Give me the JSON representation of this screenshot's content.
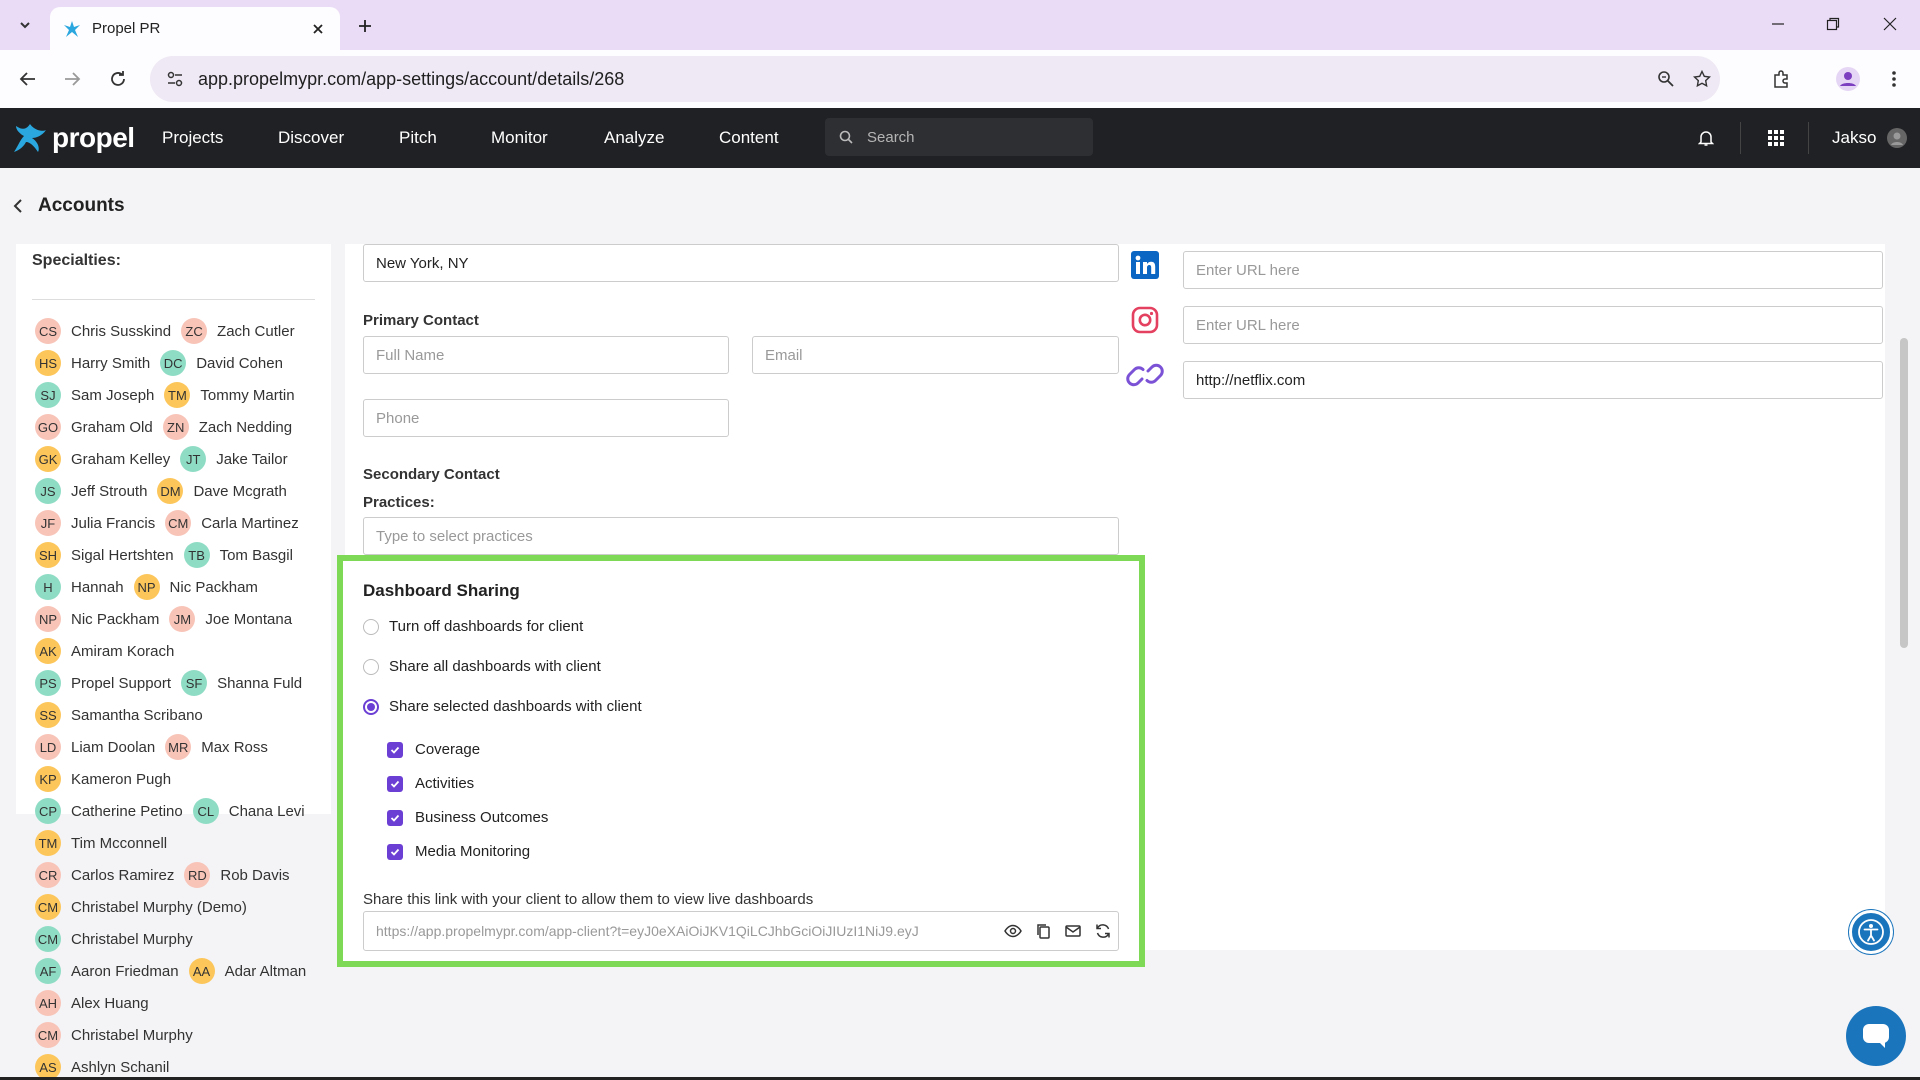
{
  "browser": {
    "tab_title": "Propel PR",
    "url": "app.propelmypr.com/app-settings/account/details/268"
  },
  "nav": {
    "logo_text": "propel",
    "links": [
      "Projects",
      "Discover",
      "Pitch",
      "Monitor",
      "Analyze",
      "Content"
    ],
    "search_placeholder": "Search",
    "username": "Jakso"
  },
  "page": {
    "back_label": "Accounts"
  },
  "sidebar": {
    "specialties_label": "Specialties:",
    "rows": [
      [
        {
          "initials": "CS",
          "name": "Chris Susskind",
          "color": "#f8c4b8"
        },
        {
          "initials": "ZC",
          "name": "Zach Cutler",
          "color": "#f8c4b8"
        }
      ],
      [
        {
          "initials": "HS",
          "name": "Harry Smith",
          "color": "#fcc65b"
        },
        {
          "initials": "DC",
          "name": "David Cohen",
          "color": "#8fdcc5"
        }
      ],
      [
        {
          "initials": "SJ",
          "name": "Sam Joseph",
          "color": "#8fdcc5"
        },
        {
          "initials": "TM",
          "name": "Tommy Martin",
          "color": "#fcc65b"
        }
      ],
      [
        {
          "initials": "GO",
          "name": "Graham Old",
          "color": "#f8c4b8"
        },
        {
          "initials": "ZN",
          "name": "Zach Nedding",
          "color": "#f8c4b8"
        }
      ],
      [
        {
          "initials": "GK",
          "name": "Graham Kelley",
          "color": "#fcc65b"
        },
        {
          "initials": "JT",
          "name": "Jake Tailor",
          "color": "#8fdcc5"
        }
      ],
      [
        {
          "initials": "JS",
          "name": "Jeff Strouth",
          "color": "#8fdcc5"
        },
        {
          "initials": "DM",
          "name": "Dave Mcgrath",
          "color": "#fcc65b"
        }
      ],
      [
        {
          "initials": "JF",
          "name": "Julia Francis",
          "color": "#f8c4b8"
        },
        {
          "initials": "CM",
          "name": "Carla Martinez",
          "color": "#f8c4b8"
        }
      ],
      [
        {
          "initials": "SH",
          "name": "Sigal Hertshten",
          "color": "#fcc65b"
        },
        {
          "initials": "TB",
          "name": "Tom Basgil",
          "color": "#8fdcc5"
        }
      ],
      [
        {
          "initials": "H",
          "name": "Hannah",
          "color": "#8fdcc5"
        },
        {
          "initials": "NP",
          "name": "Nic Packham",
          "color": "#fcc65b"
        }
      ],
      [
        {
          "initials": "NP",
          "name": "Nic Packham",
          "color": "#f8c4b8"
        },
        {
          "initials": "JM",
          "name": "Joe Montana",
          "color": "#f8c4b8"
        }
      ],
      [
        {
          "initials": "AK",
          "name": "Amiram Korach",
          "color": "#fcc65b"
        }
      ],
      [
        {
          "initials": "PS",
          "name": "Propel Support",
          "color": "#8fdcc5"
        },
        {
          "initials": "SF",
          "name": "Shanna Fuld",
          "color": "#8fdcc5"
        }
      ],
      [
        {
          "initials": "SS",
          "name": "Samantha Scribano",
          "color": "#fcc65b"
        }
      ],
      [
        {
          "initials": "LD",
          "name": "Liam Doolan",
          "color": "#f8c4b8"
        },
        {
          "initials": "MR",
          "name": "Max Ross",
          "color": "#f8c4b8"
        }
      ],
      [
        {
          "initials": "KP",
          "name": "Kameron Pugh",
          "color": "#fcc65b"
        }
      ],
      [
        {
          "initials": "CP",
          "name": "Catherine Petino",
          "color": "#8fdcc5"
        },
        {
          "initials": "CL",
          "name": "Chana Levi",
          "color": "#8fdcc5"
        }
      ],
      [
        {
          "initials": "TM",
          "name": "Tim Mcconnell",
          "color": "#fcc65b"
        }
      ],
      [
        {
          "initials": "CR",
          "name": "Carlos Ramirez",
          "color": "#f8c4b8"
        },
        {
          "initials": "RD",
          "name": "Rob Davis",
          "color": "#f8c4b8"
        }
      ],
      [
        {
          "initials": "CM",
          "name": "Christabel Murphy (Demo)",
          "color": "#fcc65b"
        }
      ],
      [
        {
          "initials": "CM",
          "name": "Christabel Murphy",
          "color": "#8fdcc5"
        }
      ],
      [
        {
          "initials": "AF",
          "name": "Aaron Friedman",
          "color": "#8fdcc5"
        },
        {
          "initials": "AA",
          "name": "Adar Altman",
          "color": "#fcc65b"
        }
      ],
      [
        {
          "initials": "AH",
          "name": "Alex Huang",
          "color": "#f8c4b8"
        }
      ],
      [
        {
          "initials": "CM",
          "name": "Christabel Murphy",
          "color": "#f8c4b8"
        }
      ],
      [
        {
          "initials": "AS",
          "name": "Ashlyn Schanil",
          "color": "#fcc65b"
        }
      ]
    ]
  },
  "form": {
    "location_value": "New York, NY",
    "primary_contact_label": "Primary Contact",
    "full_name_placeholder": "Full Name",
    "email_placeholder": "Email",
    "phone_placeholder": "Phone",
    "secondary_contact_label": "Secondary Contact",
    "practices_label": "Practices:",
    "practices_placeholder": "Type to select practices",
    "linkedin_placeholder": "Enter URL here",
    "instagram_placeholder": "Enter URL here",
    "website_value": "http://netflix.com"
  },
  "dashboard_sharing": {
    "title": "Dashboard Sharing",
    "options": [
      {
        "label": "Turn off dashboards for client",
        "selected": false
      },
      {
        "label": "Share all dashboards with client",
        "selected": false
      },
      {
        "label": "Share selected dashboards with client",
        "selected": true
      }
    ],
    "dashboards": [
      {
        "label": "Coverage",
        "checked": true
      },
      {
        "label": "Activities",
        "checked": true
      },
      {
        "label": "Business Outcomes",
        "checked": true
      },
      {
        "label": "Media Monitoring",
        "checked": true
      }
    ],
    "share_label": "Share this link with your client to allow them to view live dashboards",
    "share_url": "https://app.propelmypr.com/app-client?t=eyJ0eXAiOiJKV1QiLCJhbGciOiJIUzI1NiJ9.eyJ"
  },
  "colors": {
    "accent": "#6c3fd4",
    "highlight_border": "#7ed957",
    "nav_bg": "#202124",
    "tabstrip_bg": "#eadcf6"
  }
}
